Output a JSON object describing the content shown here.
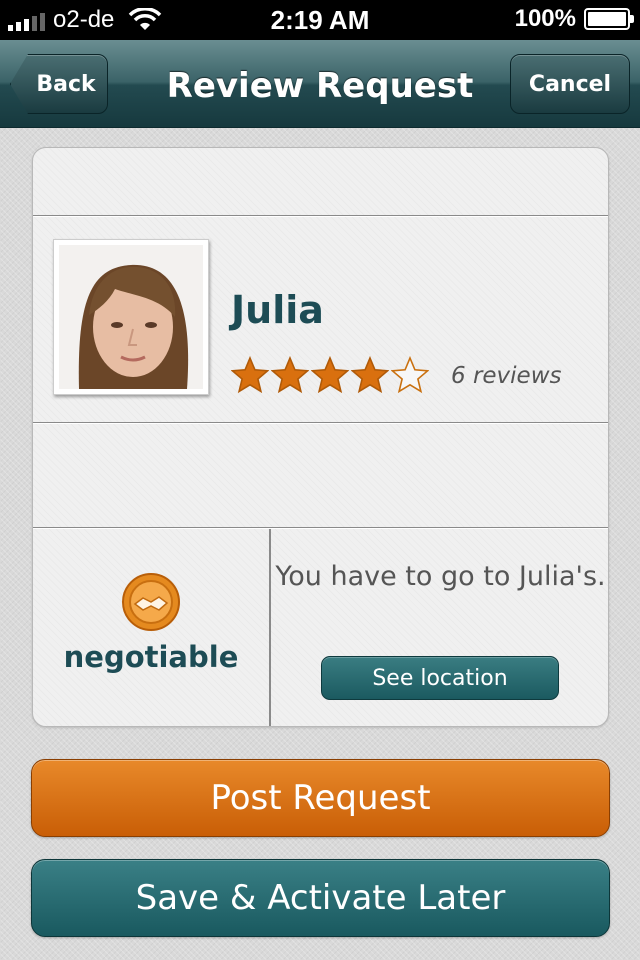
{
  "status_bar": {
    "carrier": "o2-de",
    "time": "2:19 AM",
    "battery": "100%",
    "signal_bars": 3,
    "signal_max": 5
  },
  "nav": {
    "title": "Review Request",
    "back_label": "Back",
    "cancel_label": "Cancel"
  },
  "profile": {
    "name": "Julia",
    "rating": 4,
    "rating_max": 5,
    "reviews_label": "6 reviews"
  },
  "price": {
    "label": "negotiable"
  },
  "location": {
    "text": "You have to go to Julia's.",
    "button_label": "See location"
  },
  "actions": {
    "post_label": "Post Request",
    "save_label": "Save & Activate Later"
  },
  "colors": {
    "accent_orange": "#d96b10",
    "accent_teal": "#1d4c55",
    "star_filled": "#d9700f"
  }
}
